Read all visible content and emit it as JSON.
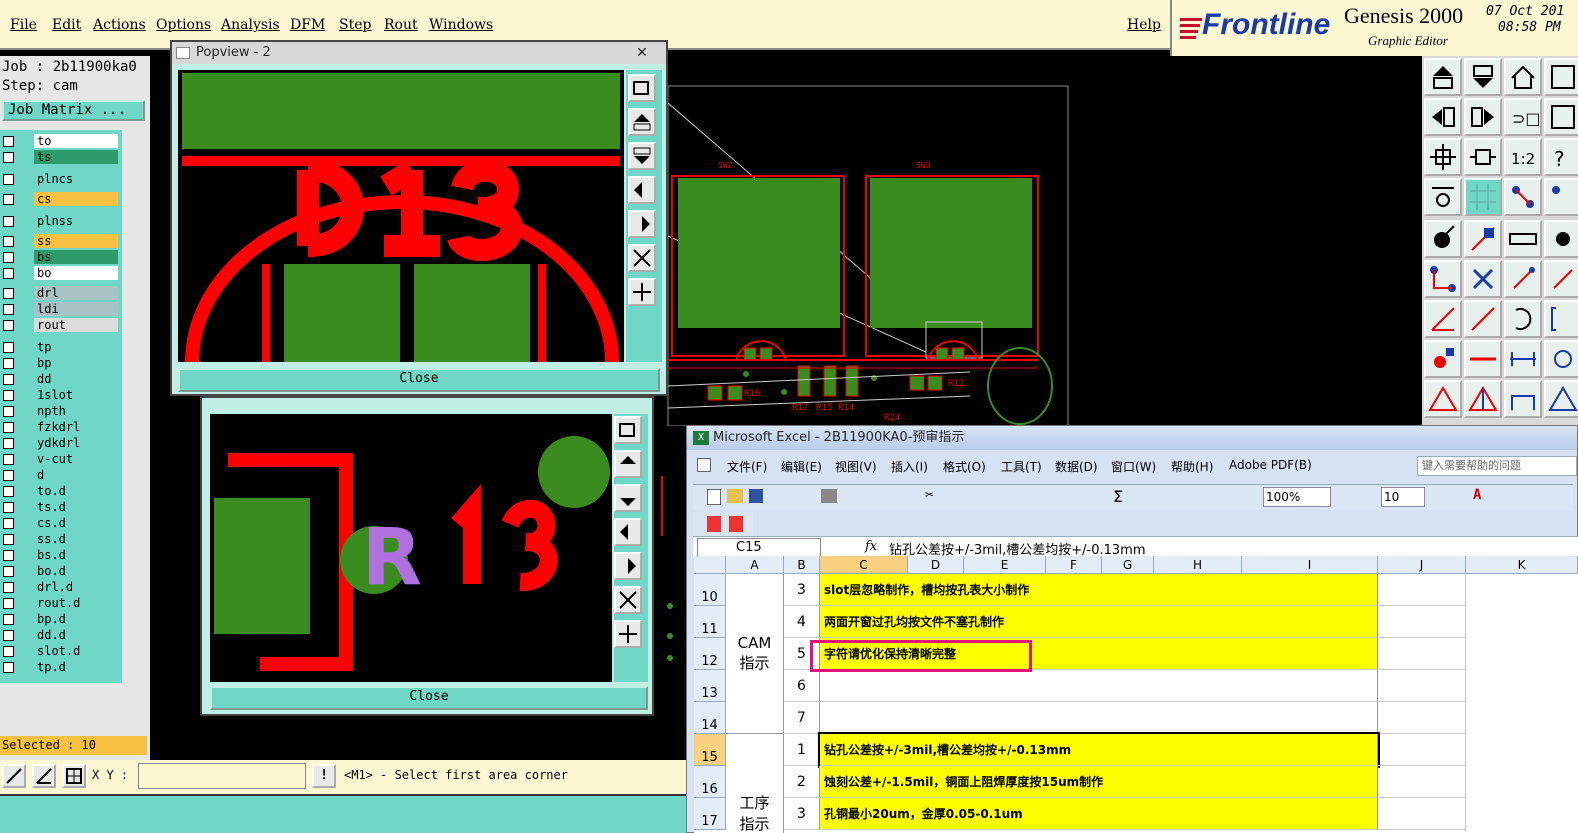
{
  "menubar": {
    "items": [
      "File",
      "Edit",
      "Actions",
      "Options",
      "Analysis",
      "DFM",
      "Step",
      "Rout",
      "Windows"
    ],
    "help": "Help"
  },
  "brand": {
    "logo": "Frontline",
    "product": "Genesis 2000",
    "subtitle": "Graphic Editor",
    "date": "07 Oct 201",
    "time": "08:58 PM"
  },
  "job": {
    "job_line": "Job : 2b11900ka0",
    "step_line": "Step: cam",
    "matrix_button": "Job Matrix ..."
  },
  "layers": [
    {
      "name": "to",
      "color": "#ffffff"
    },
    {
      "name": "ts",
      "color": "#2e9b6a"
    },
    {
      "name": "plncs",
      "color": "#70d7c6"
    },
    {
      "name": "cs",
      "color": "#f6c040"
    },
    {
      "name": "plnss",
      "color": "#70d7c6"
    },
    {
      "name": "ss",
      "color": "#f6c040"
    },
    {
      "name": "bs",
      "color": "#2e9b6a"
    },
    {
      "name": "bo",
      "color": "#ffffff"
    },
    {
      "name": "drl",
      "color": "#a9c2c5"
    },
    {
      "name": "ldi",
      "color": "#a9c2c5"
    },
    {
      "name": "rout",
      "color": "#dcdcdc"
    },
    {
      "name": "tp",
      "color": "#70d7c6"
    },
    {
      "name": "bp",
      "color": "#70d7c6"
    },
    {
      "name": "dd",
      "color": "#70d7c6"
    },
    {
      "name": "1slot",
      "color": "#70d7c6"
    },
    {
      "name": "npth",
      "color": "#70d7c6"
    },
    {
      "name": "fzkdrl",
      "color": "#70d7c6"
    },
    {
      "name": "ydkdrl",
      "color": "#70d7c6"
    },
    {
      "name": "v-cut",
      "color": "#70d7c6"
    },
    {
      "name": "d",
      "color": "#70d7c6"
    },
    {
      "name": "to.d",
      "color": "#70d7c6"
    },
    {
      "name": "ts.d",
      "color": "#70d7c6"
    },
    {
      "name": "cs.d",
      "color": "#70d7c6"
    },
    {
      "name": "ss.d",
      "color": "#70d7c6"
    },
    {
      "name": "bs.d",
      "color": "#70d7c6"
    },
    {
      "name": "bo.d",
      "color": "#70d7c6"
    },
    {
      "name": "drl.d",
      "color": "#70d7c6"
    },
    {
      "name": "rout.d",
      "color": "#70d7c6"
    },
    {
      "name": "bp.d",
      "color": "#70d7c6"
    },
    {
      "name": "dd.d",
      "color": "#70d7c6"
    },
    {
      "name": "slot.d",
      "color": "#70d7c6"
    },
    {
      "name": "tp.d",
      "color": "#70d7c6"
    }
  ],
  "status": {
    "selected": "Selected : 10",
    "xy_label": "X Y :",
    "xy_value": "",
    "prompt": "<M1> - Select first area corner"
  },
  "popview": {
    "title": "Popview - 2",
    "close_label": "Close",
    "second_close_label": "Close"
  },
  "pcb": {
    "labels": {
      "sw2": "SW2",
      "sw3": "SW3",
      "r16": "R16",
      "r17": "R17",
      "r15": "R15",
      "r14": "R14",
      "r24": "R24",
      "r12": "R12"
    }
  },
  "excel": {
    "title": "Microsoft Excel - 2B11900KA0-预审指示",
    "menus": [
      "文件(F)",
      "编辑(E)",
      "视图(V)",
      "插入(I)",
      "格式(O)",
      "工具(T)",
      "数据(D)",
      "窗口(W)",
      "帮助(H)",
      "Adobe PDF(B)"
    ],
    "help_box": "键入需要帮助的问题",
    "zoom": "100%",
    "font_size": "10",
    "name_box": "C15",
    "formula": "钻孔公差按+/-3mil,槽公差均按+/-0.13mm",
    "columns": [
      "A",
      "B",
      "C",
      "D",
      "E",
      "F",
      "G",
      "H",
      "I",
      "J",
      "K"
    ],
    "rows": [
      {
        "row": "10",
        "num": "3",
        "text": "slot层忽略制作，槽均按孔表大小制作",
        "yellow": true
      },
      {
        "row": "11",
        "num": "4",
        "text": "两面开窗过孔均按文件不塞孔制作",
        "yellow": true
      },
      {
        "row": "12",
        "num": "5",
        "text": "字符请优化保持清晰完整",
        "yellow": true
      },
      {
        "row": "13",
        "num": "6",
        "text": "",
        "yellow": false
      },
      {
        "row": "14",
        "num": "7",
        "text": "",
        "yellow": false
      },
      {
        "row": "15",
        "num": "1",
        "text": "钻孔公差按+/-3mil,槽公差均按+/-0.13mm",
        "yellow": true
      },
      {
        "row": "16",
        "num": "2",
        "text": "蚀刻公差+/-1.5mil，铜面上阻焊厚度按15um制作",
        "yellow": true
      },
      {
        "row": "17",
        "num": "3",
        "text": "孔铜最小20um，金厚0.05-0.1um",
        "yellow": true
      }
    ],
    "group_a1": "CAM指示",
    "group_a2": "工序指示"
  }
}
